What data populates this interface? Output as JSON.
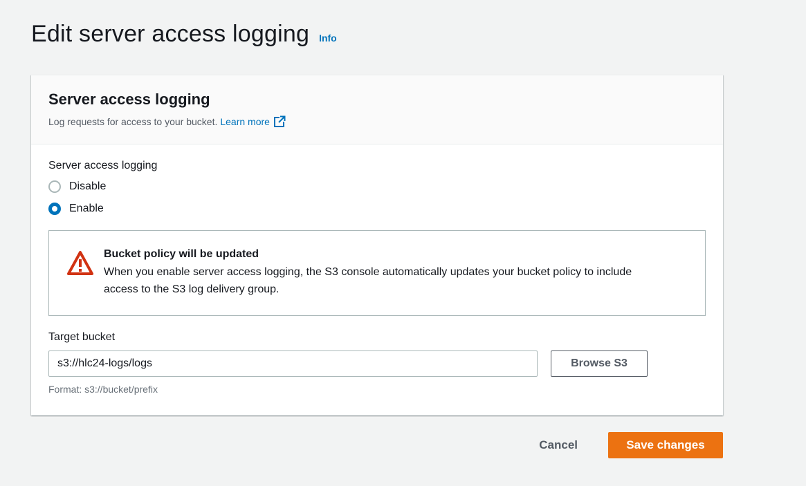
{
  "header": {
    "title": "Edit server access logging",
    "info_label": "Info"
  },
  "container": {
    "title": "Server access logging",
    "description": "Log requests for access to your bucket.",
    "learn_more": "Learn more"
  },
  "logging": {
    "label": "Server access logging",
    "options": [
      {
        "label": "Disable",
        "selected": false
      },
      {
        "label": "Enable",
        "selected": true
      }
    ]
  },
  "alert": {
    "title": "Bucket policy will be updated",
    "text": "When you enable server access logging, the S3 console automatically updates your bucket policy to include access to the S3 log delivery group."
  },
  "target": {
    "label": "Target bucket",
    "value": "s3://hlc24-logs/logs",
    "browse_label": "Browse S3",
    "hint": "Format: s3://bucket/prefix"
  },
  "actions": {
    "cancel_label": "Cancel",
    "save_label": "Save changes"
  },
  "colors": {
    "accent": "#0073bb",
    "primary_button": "#ec7211",
    "warning": "#d13212"
  },
  "icons": {
    "external_link": "external-link-icon",
    "warning": "warning-icon"
  }
}
